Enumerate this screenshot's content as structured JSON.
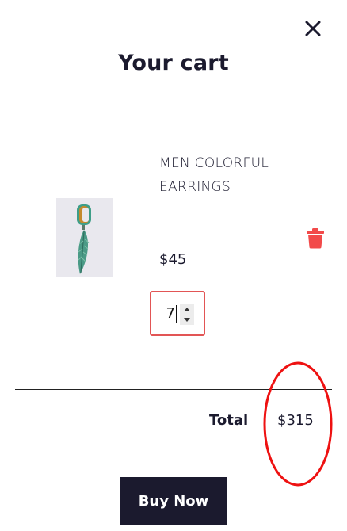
{
  "cart": {
    "title": "Your cart",
    "close_icon": "close-icon",
    "items": [
      {
        "name": "MEN COLORFUL EARRINGS",
        "price": "$45",
        "quantity": "7",
        "image_icon": "feather-earring-image",
        "delete_icon": "trash-icon",
        "delete_color": "#f24a4a"
      }
    ],
    "total_label": "Total",
    "total_value": "$315",
    "buy_label": "Buy Now"
  },
  "colors": {
    "primary": "#1b1a2e",
    "danger": "#f24a4a",
    "qty_border": "#e25555",
    "annotation": "#ee1111"
  }
}
